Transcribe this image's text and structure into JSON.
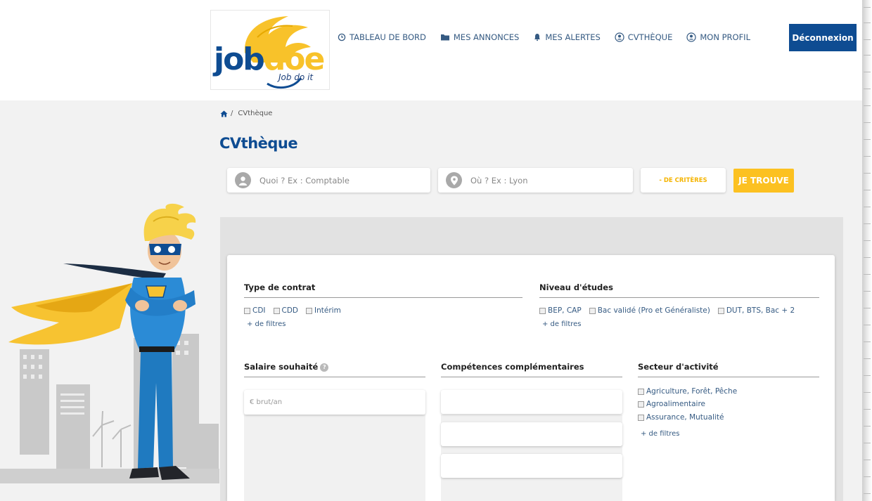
{
  "header": {
    "logo": {
      "brand_part1": "job",
      "brand_part2": "doe",
      "tagline": "Job do it"
    },
    "nav": [
      {
        "label": "TABLEAU DE BORD",
        "icon": "clock-icon"
      },
      {
        "label": "MES ANNONCES",
        "icon": "folder-icon"
      },
      {
        "label": "MES ALERTES",
        "icon": "bell-icon"
      },
      {
        "label": "CVTHÈQUE",
        "icon": "user-search-icon"
      },
      {
        "label": "MON PROFIL",
        "icon": "profile-icon"
      }
    ],
    "logout_label": "Déconnexion"
  },
  "breadcrumb": {
    "home_icon": "home-icon",
    "separator": "/",
    "current": "CVthèque"
  },
  "page_title": "CVthèque",
  "search": {
    "what_placeholder": "Quoi ? Ex : Comptable",
    "where_placeholder": "Où ? Ex : Lyon",
    "criteria_label": "- DE CRITÈRES",
    "find_label": "JE TROUVE"
  },
  "filters": {
    "contract": {
      "title": "Type de contrat",
      "options": [
        "CDI",
        "CDD",
        "Intérim"
      ],
      "more": "+ de filtres"
    },
    "education": {
      "title": "Niveau d'études",
      "options": [
        "BEP, CAP",
        "Bac validé (Pro et Généraliste)",
        "DUT, BTS, Bac + 2"
      ],
      "more": "+ de filtres"
    },
    "salary": {
      "title": "Salaire souhaité",
      "info_icon": "?",
      "placeholder": "€ brut/an"
    },
    "skills": {
      "title": "Compétences complémentaires"
    },
    "sector": {
      "title": "Secteur d'activité",
      "options": [
        "Agriculture, Forêt, Pêche",
        "Agroalimentaire",
        "Assurance, Mutualité"
      ],
      "more": "+ de filtres"
    }
  },
  "colors": {
    "primary": "#0e4c92",
    "accent": "#fcc121",
    "background": "#f2f2f2"
  }
}
